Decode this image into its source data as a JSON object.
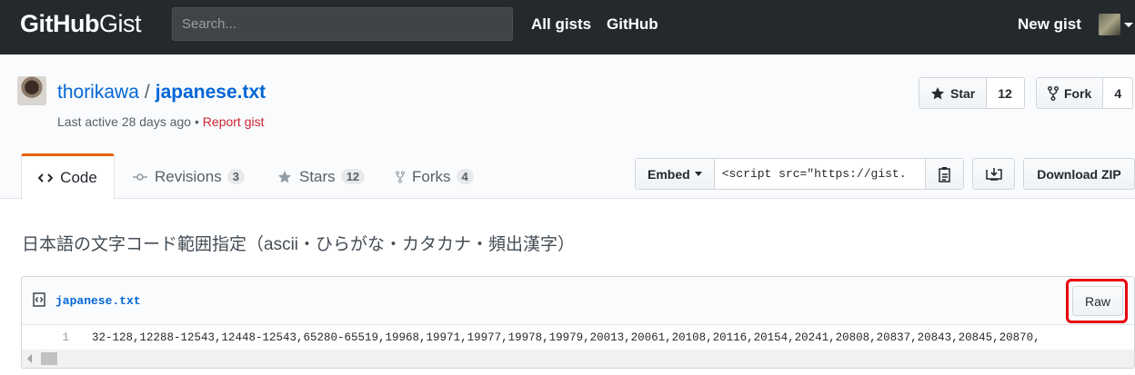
{
  "header": {
    "logo_bold": "GitHub",
    "logo_light": "Gist",
    "search_placeholder": "Search...",
    "nav": [
      "All gists",
      "GitHub"
    ],
    "new_gist": "New gist"
  },
  "gist": {
    "owner": "thorikawa",
    "separator": "/",
    "file_title": "japanese.txt",
    "last_active": "Last active 28 days ago",
    "meta_sep": "•",
    "report": "Report gist",
    "star_label": "Star",
    "star_count": "12",
    "fork_label": "Fork",
    "fork_count": "4"
  },
  "tabs": [
    {
      "label": "Code",
      "count": ""
    },
    {
      "label": "Revisions",
      "count": "3"
    },
    {
      "label": "Stars",
      "count": "12"
    },
    {
      "label": "Forks",
      "count": "4"
    }
  ],
  "embed": {
    "label": "Embed",
    "value": "<script src=\"https://gist."
  },
  "download_zip": "Download ZIP",
  "description": "日本語の文字コード範囲指定（ascii・ひらがな・カタカナ・頻出漢字）",
  "file": {
    "name": "japanese.txt",
    "raw": "Raw",
    "line_number": "1",
    "line_content": "32-128,12288-12543,12448-12543,65280-65519,19968,19971,19977,19978,19979,20013,20061,20108,20116,20154,20241,20808,20837,20843,20845,20870,"
  },
  "colors": {
    "header_bg": "#24292e",
    "link": "#0366d6",
    "report": "#cb2431",
    "tab_accent": "#e36209",
    "highlight_box": "#e8000b"
  }
}
